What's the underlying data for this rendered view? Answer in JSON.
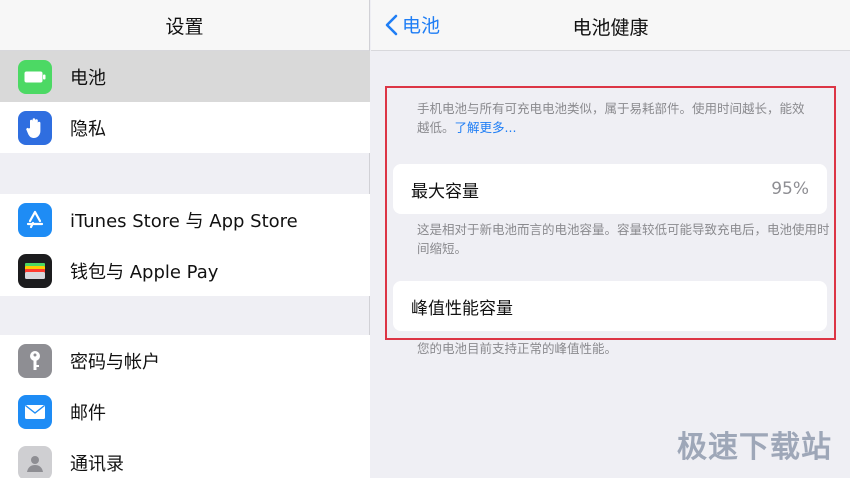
{
  "left": {
    "title": "设置",
    "items": [
      {
        "label": "电池",
        "icon": "battery-icon",
        "selected": true
      },
      {
        "label": "隐私",
        "icon": "hand-icon"
      },
      {
        "label": "iTunes Store 与 App Store",
        "icon": "appstore-icon"
      },
      {
        "label": "钱包与 Apple Pay",
        "icon": "wallet-icon"
      },
      {
        "label": "密码与帐户",
        "icon": "key-icon"
      },
      {
        "label": "邮件",
        "icon": "mail-icon"
      },
      {
        "label": "通讯录",
        "icon": "contacts-icon"
      }
    ]
  },
  "right": {
    "back_label": "电池",
    "title": "电池健康",
    "intro_text": "手机电池与所有可充电电池类似，属于易耗部件。使用时间越长，能效越低。",
    "learn_more": "了解更多...",
    "max_capacity_label": "最大容量",
    "max_capacity_value": "95%",
    "max_capacity_note": "这是相对于新电池而言的电池容量。容量较低可能导致充电后，电池使用时间缩短。",
    "peak_label": "峰值性能容量",
    "peak_note": "您的电池目前支持正常的峰值性能。"
  },
  "watermark": "极速下载站",
  "colors": {
    "accent": "#1f7ef5",
    "highlight_box": "#dc3545"
  }
}
